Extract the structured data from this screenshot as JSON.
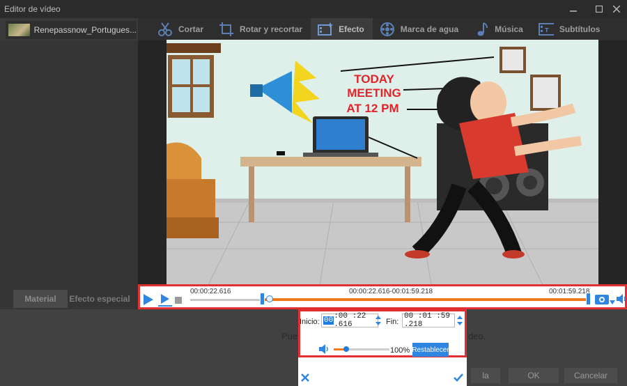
{
  "window": {
    "title": "Editor de vídeo",
    "controls": [
      "minimize",
      "maximize",
      "close"
    ]
  },
  "file_tab": {
    "name": "Renepassnow_Portugues..."
  },
  "toolbar": {
    "items": [
      {
        "label": "Cortar",
        "icon": "cut-icon"
      },
      {
        "label": "Rotar y recortar",
        "icon": "crop-icon"
      },
      {
        "label": "Efecto",
        "icon": "effect-icon",
        "active": true
      },
      {
        "label": "Marca de agua",
        "icon": "watermark-icon"
      },
      {
        "label": "Música",
        "icon": "music-icon"
      },
      {
        "label": "Subtítulos",
        "icon": "subtitles-icon"
      }
    ]
  },
  "sidebar": {
    "tabs": [
      "Material",
      "Efecto especial"
    ]
  },
  "preview": {
    "headline": [
      "TODAY",
      "MEETING",
      "AT 12 PM"
    ]
  },
  "playback": {
    "start_time": "00:00:22.616",
    "range_time": "00:00:22.616-00:01:59.218",
    "end_time": "00:01:59.218",
    "progress_start_fraction": 0.188,
    "progress_end_fraction": 1.0
  },
  "trim": {
    "start_label": "Inicio:",
    "start_hh": "00",
    "start_rest": ":00 :22 .616",
    "end_label": "Fin:",
    "end_value": "00 :01 :59 .218",
    "volume_percent": "100%",
    "volume_level": 0.22,
    "reset_label": "Restablecer"
  },
  "behind_dialog": {
    "text_left": "Pue",
    "text_right": "deo.",
    "ok_label": "OK",
    "cancel_label": "Cancelar",
    "hidden_button_label": "la"
  },
  "colors": {
    "accent_orange": "#f07a1a",
    "accent_blue": "#1e7be0",
    "highlight_red": "#e03030"
  }
}
